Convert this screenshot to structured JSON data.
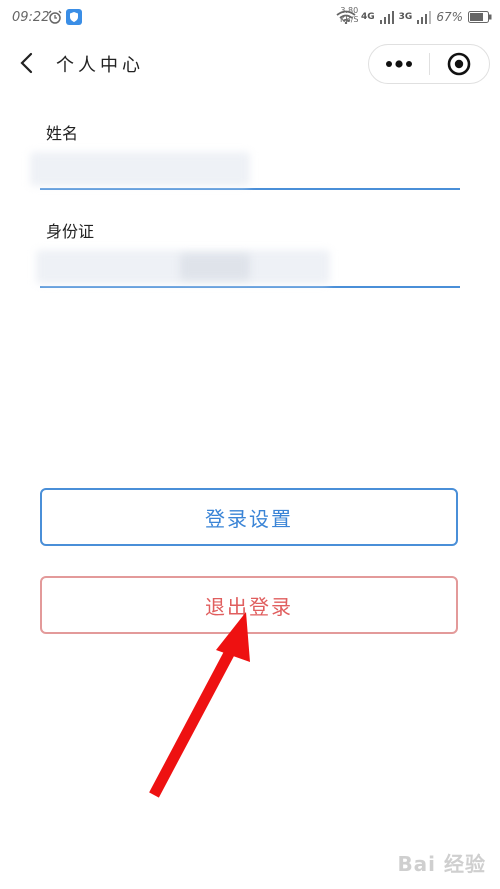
{
  "status_bar": {
    "time": "09:22",
    "speed_value": "3.80",
    "speed_unit": "KB/S",
    "network_1": "4G",
    "network_2": "3G",
    "battery": "67%"
  },
  "nav": {
    "title": "个人中心"
  },
  "form": {
    "name_label": "姓名",
    "id_label": "身份证"
  },
  "buttons": {
    "login_settings": "登录设置",
    "logout": "退出登录"
  },
  "watermark": "Bai 经验",
  "colors": {
    "accent_blue": "#4a8fd8",
    "logout_red": "#e05e5e",
    "arrow_red": "#ee1111"
  },
  "icons": [
    "alarm-icon",
    "shield-icon",
    "wifi-icon",
    "signal-icon",
    "battery-icon",
    "back-icon",
    "more-icon",
    "target-icon"
  ]
}
